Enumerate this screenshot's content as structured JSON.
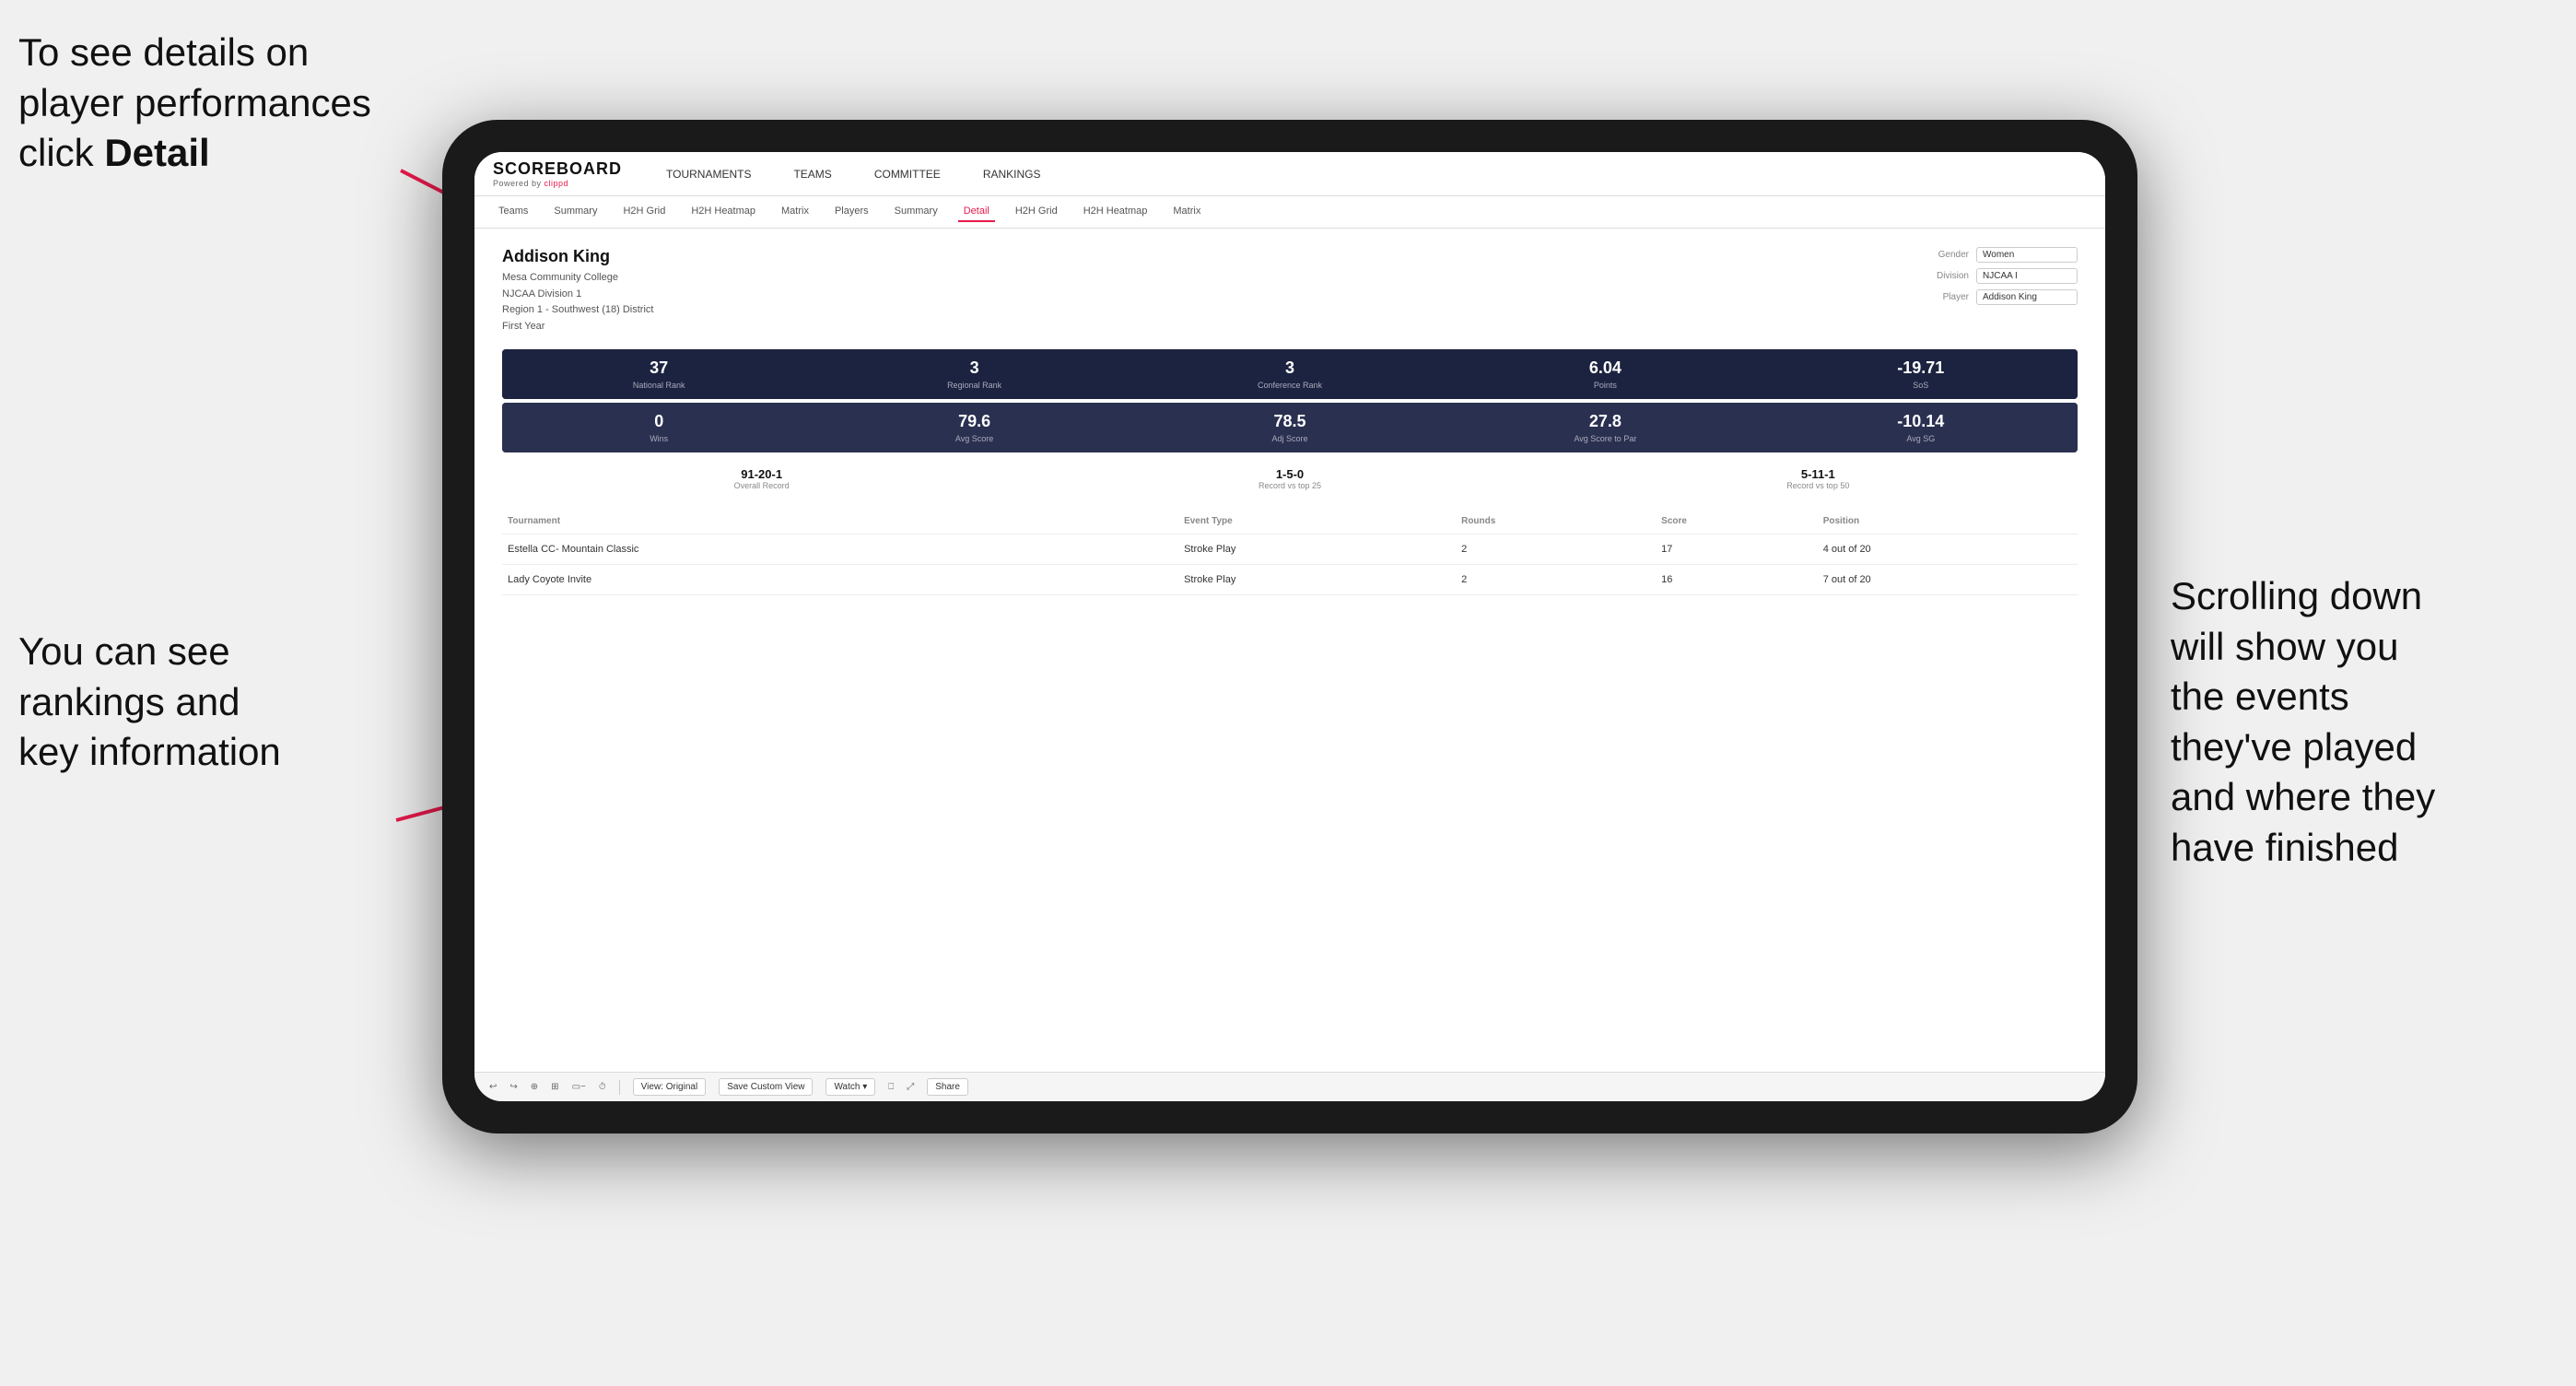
{
  "annotations": {
    "top_left": "To see details on player performances click ",
    "top_left_bold": "Detail",
    "bottom_left_line1": "You can see",
    "bottom_left_line2": "rankings and",
    "bottom_left_line3": "key information",
    "right_line1": "Scrolling down",
    "right_line2": "will show you",
    "right_line3": "the events",
    "right_line4": "they've played",
    "right_line5": "and where they",
    "right_line6": "have finished"
  },
  "header": {
    "logo_main": "SCOREBOARD",
    "logo_sub": "Powered by clippd",
    "nav_items": [
      "TOURNAMENTS",
      "TEAMS",
      "COMMITTEE",
      "RANKINGS"
    ]
  },
  "sub_nav": {
    "items": [
      "Teams",
      "Summary",
      "H2H Grid",
      "H2H Heatmap",
      "Matrix",
      "Players",
      "Summary",
      "Detail",
      "H2H Grid",
      "H2H Heatmap",
      "Matrix"
    ],
    "active": "Detail"
  },
  "player": {
    "name": "Addison King",
    "college": "Mesa Community College",
    "division": "NJCAA Division 1",
    "region": "Region 1 - Southwest (18) District",
    "year": "First Year"
  },
  "controls": {
    "gender_label": "Gender",
    "gender_value": "Women",
    "division_label": "Division",
    "division_value": "NJCAA I",
    "player_label": "Player",
    "player_value": "Addison King"
  },
  "stats_row1": [
    {
      "value": "37",
      "label": "National Rank"
    },
    {
      "value": "3",
      "label": "Regional Rank"
    },
    {
      "value": "3",
      "label": "Conference Rank"
    },
    {
      "value": "6.04",
      "label": "Points"
    },
    {
      "value": "-19.71",
      "label": "SoS"
    }
  ],
  "stats_row2": [
    {
      "value": "0",
      "label": "Wins"
    },
    {
      "value": "79.6",
      "label": "Avg Score"
    },
    {
      "value": "78.5",
      "label": "Adj Score"
    },
    {
      "value": "27.8",
      "label": "Avg Score to Par"
    },
    {
      "value": "-10.14",
      "label": "Avg SG"
    }
  ],
  "records": [
    {
      "value": "91-20-1",
      "label": "Overall Record"
    },
    {
      "value": "1-5-0",
      "label": "Record vs top 25"
    },
    {
      "value": "5-11-1",
      "label": "Record vs top 50"
    }
  ],
  "table": {
    "columns": [
      "Tournament",
      "",
      "Event Type",
      "Rounds",
      "Score",
      "Position"
    ],
    "rows": [
      {
        "tournament": "Estella CC- Mountain Classic",
        "event_type": "Stroke Play",
        "rounds": "2",
        "score": "17",
        "position": "4 out of 20"
      },
      {
        "tournament": "Lady Coyote Invite",
        "event_type": "Stroke Play",
        "rounds": "2",
        "score": "16",
        "position": "7 out of 20"
      }
    ]
  },
  "toolbar": {
    "buttons": [
      "View: Original",
      "Save Custom View",
      "Watch ▾",
      "Share"
    ]
  }
}
